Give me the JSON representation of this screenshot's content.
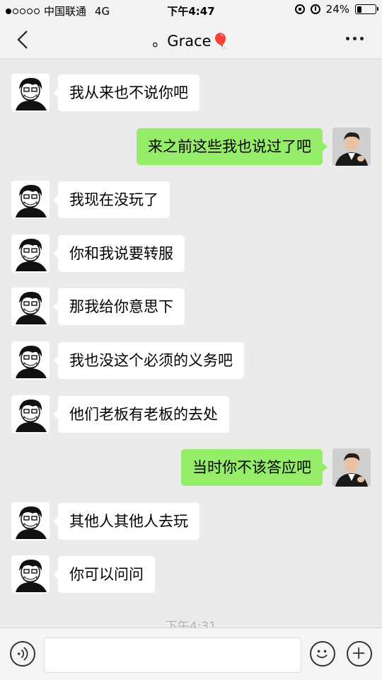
{
  "status_bar": {
    "carrier": "中国联通",
    "network": "4G",
    "time": "下午4:47",
    "battery": "24%",
    "battery_level": 0.24,
    "signal_bars_filled": 1,
    "signal_bars_total": 5
  },
  "nav": {
    "title": "。Grace🎈"
  },
  "messages": [
    {
      "side": "left",
      "text": "我从来也不说你吧"
    },
    {
      "side": "right",
      "text": "来之前这些我也说过了吧"
    },
    {
      "side": "left",
      "text": "我现在没玩了"
    },
    {
      "side": "left",
      "text": "你和我说要转服"
    },
    {
      "side": "left",
      "text": "那我给你意思下"
    },
    {
      "side": "left",
      "text": "我也没这个必须的义务吧"
    },
    {
      "side": "left",
      "text": "他们老板有老板的去处"
    },
    {
      "side": "right",
      "text": "当时你不该答应吧"
    },
    {
      "side": "left",
      "text": "其他人其他人去玩"
    },
    {
      "side": "left",
      "text": "你可以问问"
    }
  ],
  "timestamp": "下午4:31",
  "input": {
    "value": ""
  },
  "colors": {
    "background": "#ebebeb",
    "bubble_sent": "#95ec69",
    "bubble_received": "#ffffff"
  }
}
